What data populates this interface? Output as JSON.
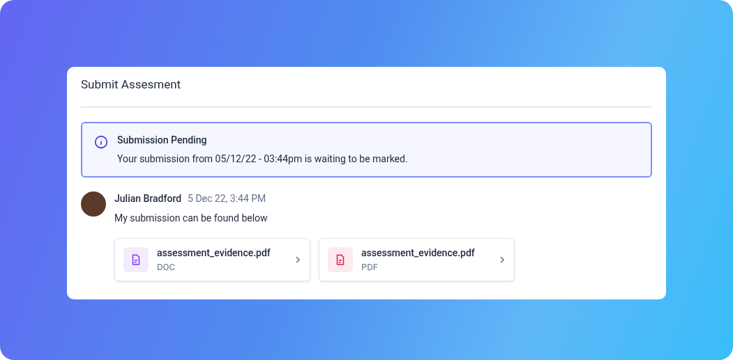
{
  "card": {
    "title": "Submit Assesment"
  },
  "alert": {
    "title": "Submission Pending",
    "message": "Your submission from 05/12/22 - 03:44pm is waiting to be marked."
  },
  "comment": {
    "author": "Julian Bradford",
    "time": "5 Dec 22, 3:44 PM",
    "text": "My submission can be found below",
    "files": [
      {
        "name": "assessment_evidence.pdf",
        "type": "DOC",
        "color": "#7c3aed"
      },
      {
        "name": "assessment_evidence.pdf",
        "type": "PDF",
        "color": "#e11d48"
      }
    ]
  }
}
